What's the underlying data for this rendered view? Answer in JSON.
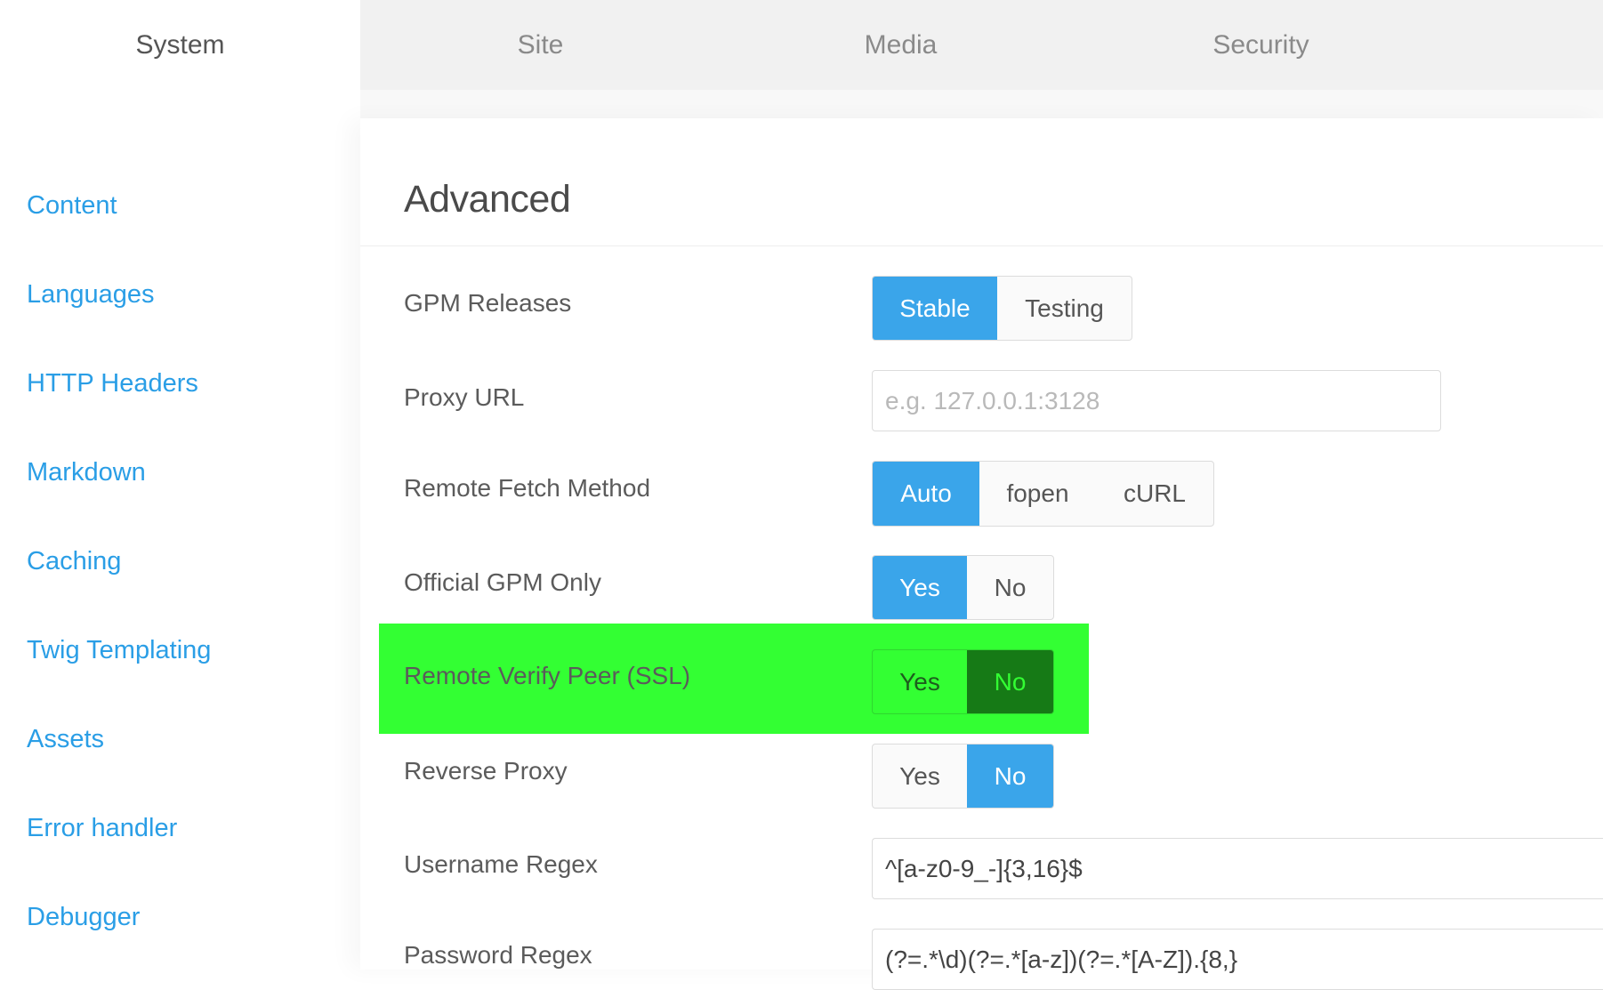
{
  "tabs": [
    {
      "label": "System",
      "active": true
    },
    {
      "label": "Site",
      "active": false
    },
    {
      "label": "Media",
      "active": false
    },
    {
      "label": "Security",
      "active": false
    }
  ],
  "sidebar": {
    "items": [
      {
        "label": "Content"
      },
      {
        "label": "Languages"
      },
      {
        "label": "HTTP Headers"
      },
      {
        "label": "Markdown"
      },
      {
        "label": "Caching"
      },
      {
        "label": "Twig Templating"
      },
      {
        "label": "Assets"
      },
      {
        "label": "Error handler"
      },
      {
        "label": "Debugger"
      }
    ]
  },
  "main": {
    "section_title": "Advanced",
    "fields": {
      "gpm_releases": {
        "label": "GPM Releases",
        "options": [
          "Stable",
          "Testing"
        ],
        "selected": "Stable"
      },
      "proxy_url": {
        "label": "Proxy URL",
        "value": "",
        "placeholder": "e.g. 127.0.0.1:3128"
      },
      "remote_fetch_method": {
        "label": "Remote Fetch Method",
        "options": [
          "Auto",
          "fopen",
          "cURL"
        ],
        "selected": "Auto"
      },
      "official_gpm_only": {
        "label": "Official GPM Only",
        "options": [
          "Yes",
          "No"
        ],
        "selected": "Yes"
      },
      "remote_verify_peer": {
        "label": "Remote Verify Peer (SSL)",
        "options": [
          "Yes",
          "No"
        ],
        "selected": "No",
        "highlighted": true
      },
      "reverse_proxy": {
        "label": "Reverse Proxy",
        "options": [
          "Yes",
          "No"
        ],
        "selected": "No"
      },
      "username_regex": {
        "label": "Username Regex",
        "value": "^[a-z0-9_-]{3,16}$"
      },
      "password_regex": {
        "label": "Password Regex",
        "value": "(?=.*\\d)(?=.*[a-z])(?=.*[A-Z]).{8,}"
      }
    }
  },
  "colors": {
    "accent": "#3aa5ea",
    "link": "#2a9ee6",
    "highlight": "#33ff33",
    "highlight_selected": "#167a16"
  }
}
